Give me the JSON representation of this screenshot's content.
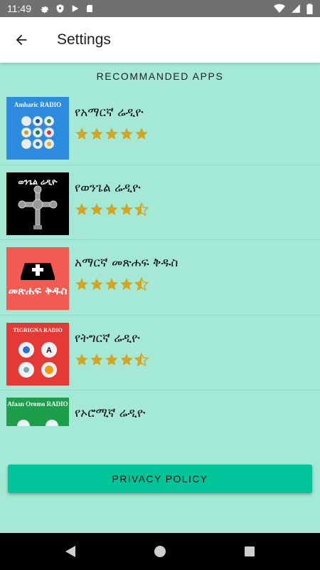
{
  "status_bar": {
    "time": "11:49"
  },
  "app_bar": {
    "title": "Settings"
  },
  "section": {
    "title": "RECOMMANDED APPS"
  },
  "apps": [
    {
      "name": "የአማርኛ ሬዲዮ",
      "rating": 5,
      "thumb_label": "Amharic RADIO",
      "thumb_color": "#2d8ce0"
    },
    {
      "name": "የወንጌል ሬዲዮ",
      "rating": 4.5,
      "thumb_label": "ወንጌል ሬዲዮ",
      "thumb_color": "#000000"
    },
    {
      "name": "አማርኛ መጽሐፍ ቅዱስ",
      "rating": 4.5,
      "thumb_label": "መጽሐፍ ቅዱስ",
      "thumb_color": "#f25a52"
    },
    {
      "name": "የትግርኛ ሬዲዮ",
      "rating": 4.5,
      "thumb_label": "TIGRIGNA RADIO",
      "thumb_color": "#e53935"
    },
    {
      "name": "የኦሮሚኛ ሬዲዮ",
      "rating": 0,
      "thumb_label": "Afaan Oromo RADIO",
      "thumb_color": "#1e9e4a"
    }
  ],
  "privacy": {
    "label": "PRIVACY POLICY"
  },
  "colors": {
    "background": "#a4e8d6",
    "button": "#00c49a",
    "star": "#d4a520"
  }
}
